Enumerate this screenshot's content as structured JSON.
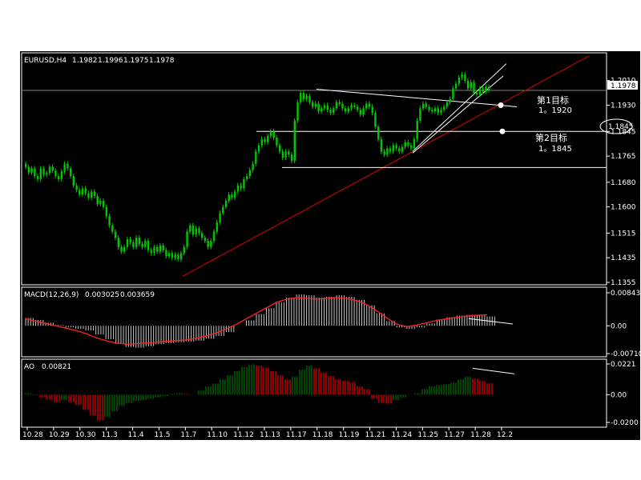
{
  "colors": {
    "background": "#000000",
    "frame": "#ffffff",
    "bull_candle": "#00c800",
    "trend_line": "#e00000",
    "macd_histogram": "#c8c8c8",
    "macd_signal": "#ff2020",
    "ao_up": "#008000",
    "ao_down": "#ff0000",
    "bid_line": "#808080",
    "text": "#ffffff"
  },
  "chart_data": [
    {
      "type": "candlestick",
      "title": "EURUSD,H4",
      "ohlc_header": [
        "1.1982",
        "1.1996",
        "1.1975",
        "1.1978"
      ],
      "current_price_label": "1.1978",
      "current_price": 1.1978,
      "ylim": [
        1.1355,
        1.2095
      ],
      "y_tick_labels": [
        "1.2010",
        "1.1930",
        "1.1845",
        "1.1765",
        "1.1680",
        "1.1600",
        "1.1515",
        "1.1435",
        "1.1355"
      ],
      "x_labels": [
        "10.28",
        "10.29",
        "10.30",
        "11.3",
        "11.4",
        "11.5",
        "11.7",
        "11.10",
        "11.12",
        "11.13",
        "11.17",
        "11.18",
        "11.19",
        "11.21",
        "11.24",
        "11.25",
        "11.27",
        "11.28",
        "12.2"
      ],
      "closes": [
        1.173,
        1.1712,
        1.1725,
        1.17,
        1.169,
        1.1725,
        1.1705,
        1.171,
        1.173,
        1.1718,
        1.17,
        1.169,
        1.1715,
        1.174,
        1.1725,
        1.17,
        1.167,
        1.1655,
        1.164,
        1.166,
        1.1645,
        1.163,
        1.165,
        1.1635,
        1.161,
        1.162,
        1.16,
        1.157,
        1.154,
        1.152,
        1.15,
        1.147,
        1.1455,
        1.147,
        1.1495,
        1.1485,
        1.147,
        1.15,
        1.148,
        1.147,
        1.149,
        1.146,
        1.145,
        1.147,
        1.1455,
        1.1475,
        1.146,
        1.144,
        1.145,
        1.1435,
        1.1445,
        1.143,
        1.145,
        1.147,
        1.152,
        1.154,
        1.151,
        1.153,
        1.1515,
        1.15,
        1.149,
        1.147,
        1.149,
        1.152,
        1.155,
        1.158,
        1.16,
        1.162,
        1.164,
        1.163,
        1.165,
        1.167,
        1.166,
        1.169,
        1.17,
        1.172,
        1.174,
        1.178,
        1.18,
        1.182,
        1.181,
        1.183,
        1.1845,
        1.1825,
        1.18,
        1.178,
        1.176,
        1.178,
        1.177,
        1.175,
        1.188,
        1.194,
        1.197,
        1.195,
        1.196,
        1.194,
        1.1925,
        1.1935,
        1.191,
        1.192,
        1.193,
        1.1915,
        1.1905,
        1.192,
        1.194,
        1.1935,
        1.192,
        1.191,
        1.192,
        1.193,
        1.1925,
        1.1915,
        1.19,
        1.192,
        1.1935,
        1.1925,
        1.1905,
        1.186,
        1.182,
        1.178,
        1.177,
        1.179,
        1.178,
        1.18,
        1.179,
        1.178,
        1.1795,
        1.181,
        1.18,
        1.179,
        1.182,
        1.188,
        1.192,
        1.1935,
        1.1925,
        1.1915,
        1.191,
        1.192,
        1.1905,
        1.1915,
        1.1925,
        1.194,
        1.195,
        1.1985,
        1.2,
        1.202,
        1.203,
        1.201,
        1.1985,
        1.2005,
        1.197,
        1.1965,
        1.1985,
        1.1975,
        1.199,
        1.1978
      ],
      "annotations": {
        "target1_title": "第1目标",
        "target1_value": "1。1920",
        "target2_title": "第2目标",
        "target2_value": "1。1845",
        "target2_price_label": "1.1845",
        "target2_price": 1.1845,
        "target1_price": 1.193,
        "support_price": 1.1728,
        "resistance_start": 1.1982
      }
    },
    {
      "type": "bar",
      "title": "MACD(12,26,9)",
      "values_label": [
        "0.003025",
        "0.003659"
      ],
      "ylim": [
        -0.0071,
        0.00843
      ],
      "y_tick_labels": [
        "0.00843",
        "0.00",
        "-0.00710"
      ],
      "histogram": [
        0.002,
        0.0015,
        0.0008,
        0.0002,
        -0.0004,
        -0.0008,
        -0.0012,
        -0.0022,
        -0.0034,
        -0.0046,
        -0.0054,
        -0.0056,
        -0.0052,
        -0.0047,
        -0.0044,
        -0.0042,
        -0.004,
        -0.0038,
        -0.0033,
        -0.0026,
        -0.0016,
        0.0,
        0.0014,
        0.003,
        0.0045,
        0.006,
        0.0072,
        0.008,
        0.0078,
        0.0072,
        0.0074,
        0.0078,
        0.0074,
        0.0066,
        0.0052,
        0.0032,
        0.0012,
        -0.0004,
        -0.0008,
        -0.0004,
        0.0006,
        0.0016,
        0.0022,
        0.0026,
        0.0028,
        0.0027,
        0.0024
      ],
      "signal": [
        0.0018,
        0.0012,
        0.0006,
        0.0,
        -0.0006,
        -0.0012,
        -0.002,
        -0.003,
        -0.0038,
        -0.0044,
        -0.0047,
        -0.0046,
        -0.0044,
        -0.0042,
        -0.004,
        -0.0038,
        -0.0036,
        -0.0032,
        -0.0026,
        -0.0018,
        -0.0008,
        0.0004,
        0.0018,
        0.0032,
        0.0046,
        0.006,
        0.0068,
        0.0072,
        0.007,
        0.0068,
        0.007,
        0.0072,
        0.007,
        0.0064,
        0.0054,
        0.0038,
        0.002,
        0.0004,
        -0.0002,
        0.0002,
        0.0008,
        0.0014,
        0.0018,
        0.0022,
        0.0025,
        0.0027,
        0.0028
      ],
      "divergence_line": [
        0.00185,
        0.00045
      ]
    },
    {
      "type": "bar",
      "title": "AO",
      "values_label": [
        "0.00821"
      ],
      "ylim": [
        -0.02,
        0.0221
      ],
      "y_tick_labels": [
        "0.0221",
        "0.00",
        "-0.0200"
      ],
      "values": [
        0.001,
        -0.0005,
        -0.002,
        -0.0035,
        -0.0055,
        -0.004,
        -0.0055,
        -0.0075,
        -0.011,
        -0.015,
        -0.0185,
        -0.016,
        -0.012,
        -0.008,
        -0.006,
        -0.0045,
        -0.004,
        -0.003,
        -0.002,
        -0.001,
        0.0005,
        0.001,
        0.0005,
        0.0,
        0.003,
        0.006,
        0.008,
        0.011,
        0.014,
        0.017,
        0.02,
        0.0218,
        0.021,
        0.0195,
        0.017,
        0.014,
        0.011,
        0.013,
        0.018,
        0.021,
        0.019,
        0.016,
        0.0135,
        0.011,
        0.01,
        0.009,
        0.006,
        0.004,
        -0.003,
        -0.006,
        -0.0065,
        -0.004,
        -0.002,
        0.0,
        0.001,
        0.004,
        0.006,
        0.007,
        0.0075,
        0.0085,
        0.011,
        0.013,
        0.0115,
        0.01,
        0.0082
      ],
      "divergence_line": [
        0.019,
        0.015
      ]
    }
  ]
}
